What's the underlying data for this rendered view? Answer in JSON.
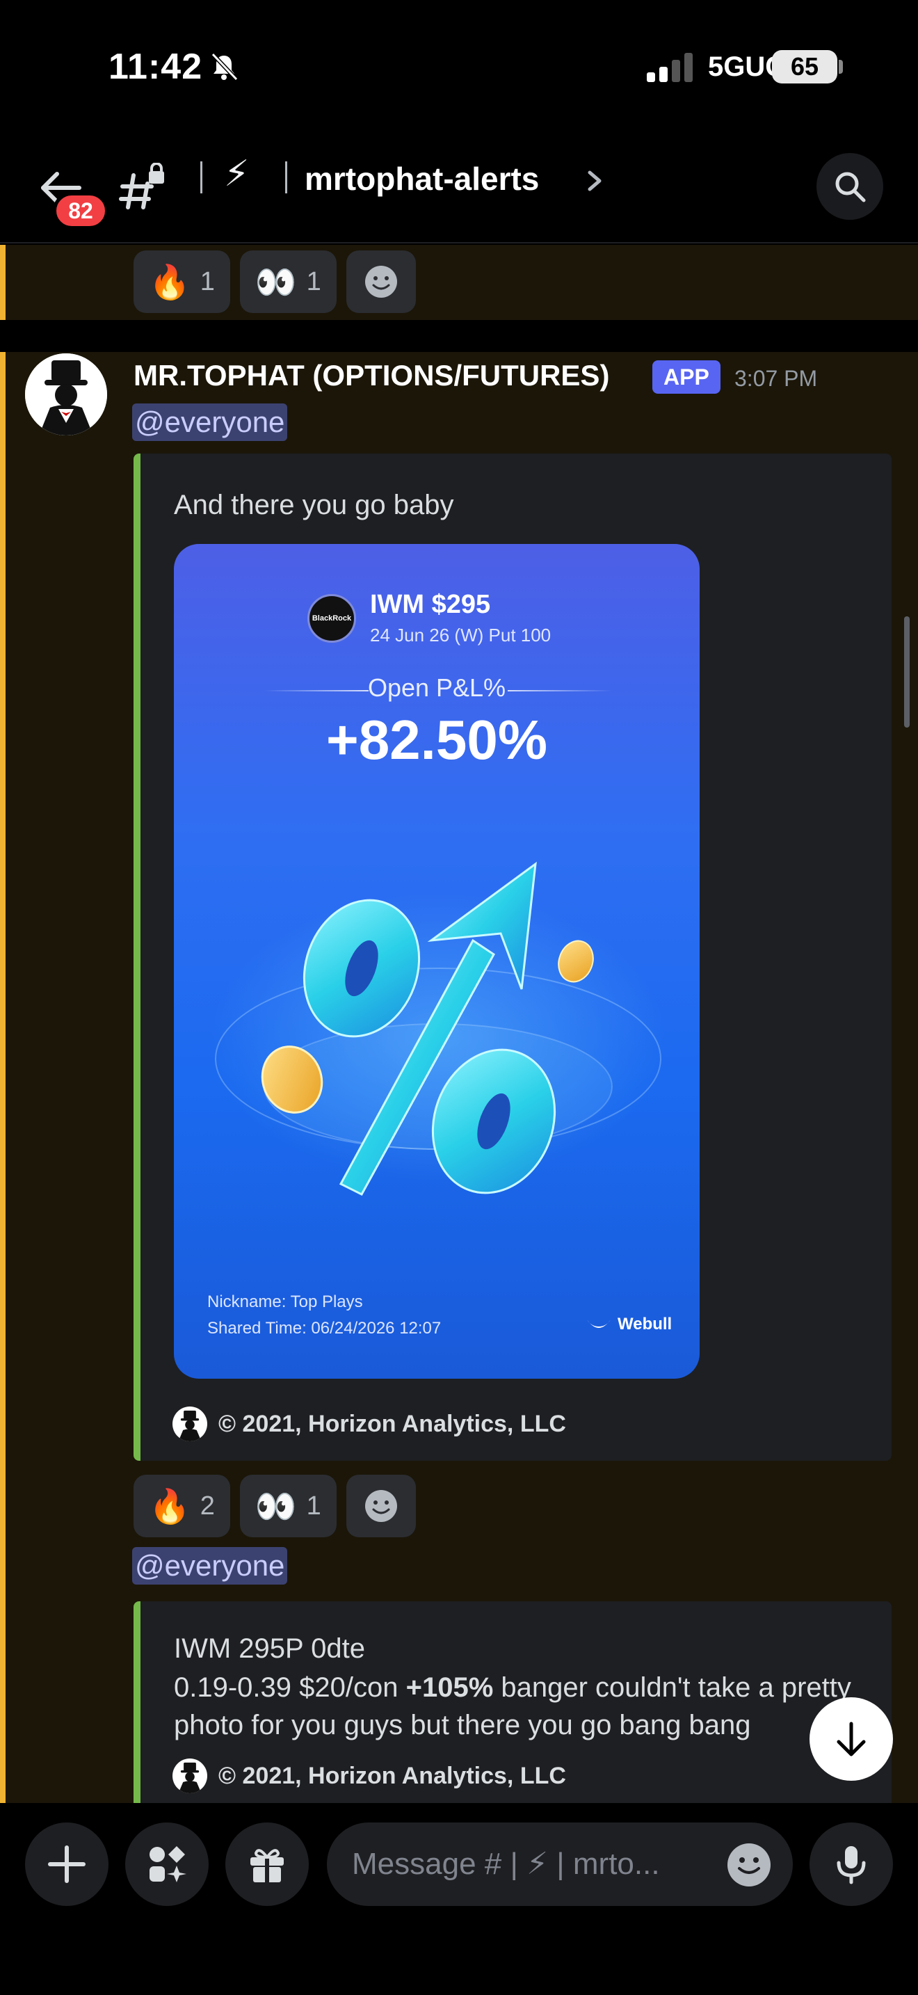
{
  "status_bar": {
    "time": "11:42",
    "network": "5GUC",
    "battery": "65"
  },
  "header": {
    "unread_badge": "82",
    "channel_emoji": "⚡",
    "channel_name": "mrtophat-alerts"
  },
  "previous_message": {
    "reactions": [
      {
        "emoji": "🔥",
        "count": "1"
      },
      {
        "emoji": "👀",
        "count": "1"
      }
    ]
  },
  "message": {
    "author": "MR.TOPHAT (OPTIONS/FUTURES)",
    "tag": "APP",
    "time": "3:07 PM",
    "mention": "@everyone",
    "embed1": {
      "text": "And there you go baby",
      "card": {
        "logo_text": "BlackRock",
        "ticker": "IWM $295",
        "contract": "24 Jun 26 (W) Put 100",
        "pl_label": "Open P&L%",
        "pl_value": "+82.50%",
        "nickname": "Nickname: Top Plays",
        "shared_time": "Shared Time: 06/24/2026 12:07",
        "brand": "Webull"
      },
      "footer": "© 2021, Horizon Analytics, LLC"
    },
    "reactions": [
      {
        "emoji": "🔥",
        "count": "2"
      },
      {
        "emoji": "👀",
        "count": "1"
      }
    ],
    "mention2": "@everyone",
    "embed2": {
      "line1": "IWM 295P 0dte",
      "line2_start": "0.19-0.39 $20/con ",
      "line2_bold": "+105%",
      "line2_end": " banger couldn't take a pretty",
      "line3": "photo for you guys but there you go bang bang",
      "footer": "© 2021, Horizon Analytics, LLC"
    }
  },
  "composer": {
    "placeholder": "Message # | ⚡ | mrto..."
  },
  "colors": {
    "accent": "#5865f2",
    "mention_highlight": "#f0b232",
    "embed_border": "#75b94b",
    "badge": "#f23f43"
  }
}
